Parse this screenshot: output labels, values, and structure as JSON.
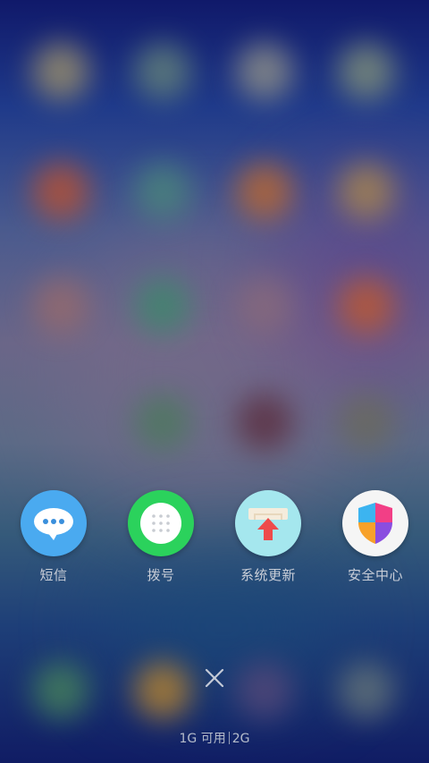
{
  "apps": [
    {
      "name": "sms",
      "label": "短信",
      "icon": "message-bubble-icon",
      "color": "#4aaaf0"
    },
    {
      "name": "dialer",
      "label": "拨号",
      "icon": "dialpad-icon",
      "color": "#2bd25c"
    },
    {
      "name": "system-update",
      "label": "系统更新",
      "icon": "upload-arrow-icon",
      "color": "#a5e7ee"
    },
    {
      "name": "security-center",
      "label": "安全中心",
      "icon": "shield-icon",
      "color": "#f5f5f5"
    }
  ],
  "memory": {
    "available": "1G 可用",
    "total": "2G"
  },
  "close_icon": "close-icon"
}
